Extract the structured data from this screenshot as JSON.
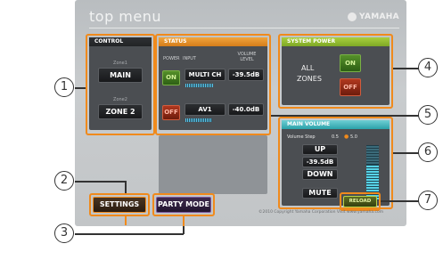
{
  "header": {
    "title": "top menu",
    "brand": "YAMAHA"
  },
  "control": {
    "title": "CONTROL",
    "zones": [
      {
        "small": "Zone1",
        "label": "MAIN"
      },
      {
        "small": "Zone2",
        "label": "ZONE 2"
      }
    ]
  },
  "status": {
    "title": "STATUS",
    "col_power": "POWER",
    "col_input": "INPUT",
    "col_volume": "VOLUME LEVEL",
    "rows": [
      {
        "power": "ON",
        "input": "MULTI CH",
        "volume": "-39.5dB",
        "level_fraction": 0.7
      },
      {
        "power": "OFF",
        "input": "AV1",
        "volume": "-40.0dB",
        "level_fraction": 0.68
      }
    ]
  },
  "system_power": {
    "title": "SYSTEM POWER",
    "label_line1": "ALL",
    "label_line2": "ZONES",
    "on": "ON",
    "off": "OFF"
  },
  "main_volume": {
    "title": "MAIN VOLUME",
    "step_label": "Volume Step",
    "step_a": "0.5",
    "step_b": "5.0",
    "up": "UP",
    "value": "-39.5dB",
    "down": "DOWN",
    "mute": "MUTE",
    "level_fraction": 0.65
  },
  "buttons": {
    "settings": "SETTINGS",
    "party": "PARTY MODE",
    "reload": "RELOAD"
  },
  "footer": "©2010 Copyright Yamaha Corporation Visit www.yamaha.com",
  "callouts": [
    "1",
    "2",
    "3",
    "4",
    "5",
    "6",
    "7"
  ],
  "colors": {
    "accent": "#f08a1c",
    "on_green": "#55902a",
    "off_red": "#b0381f",
    "meter_cyan": "#59c5ea"
  }
}
